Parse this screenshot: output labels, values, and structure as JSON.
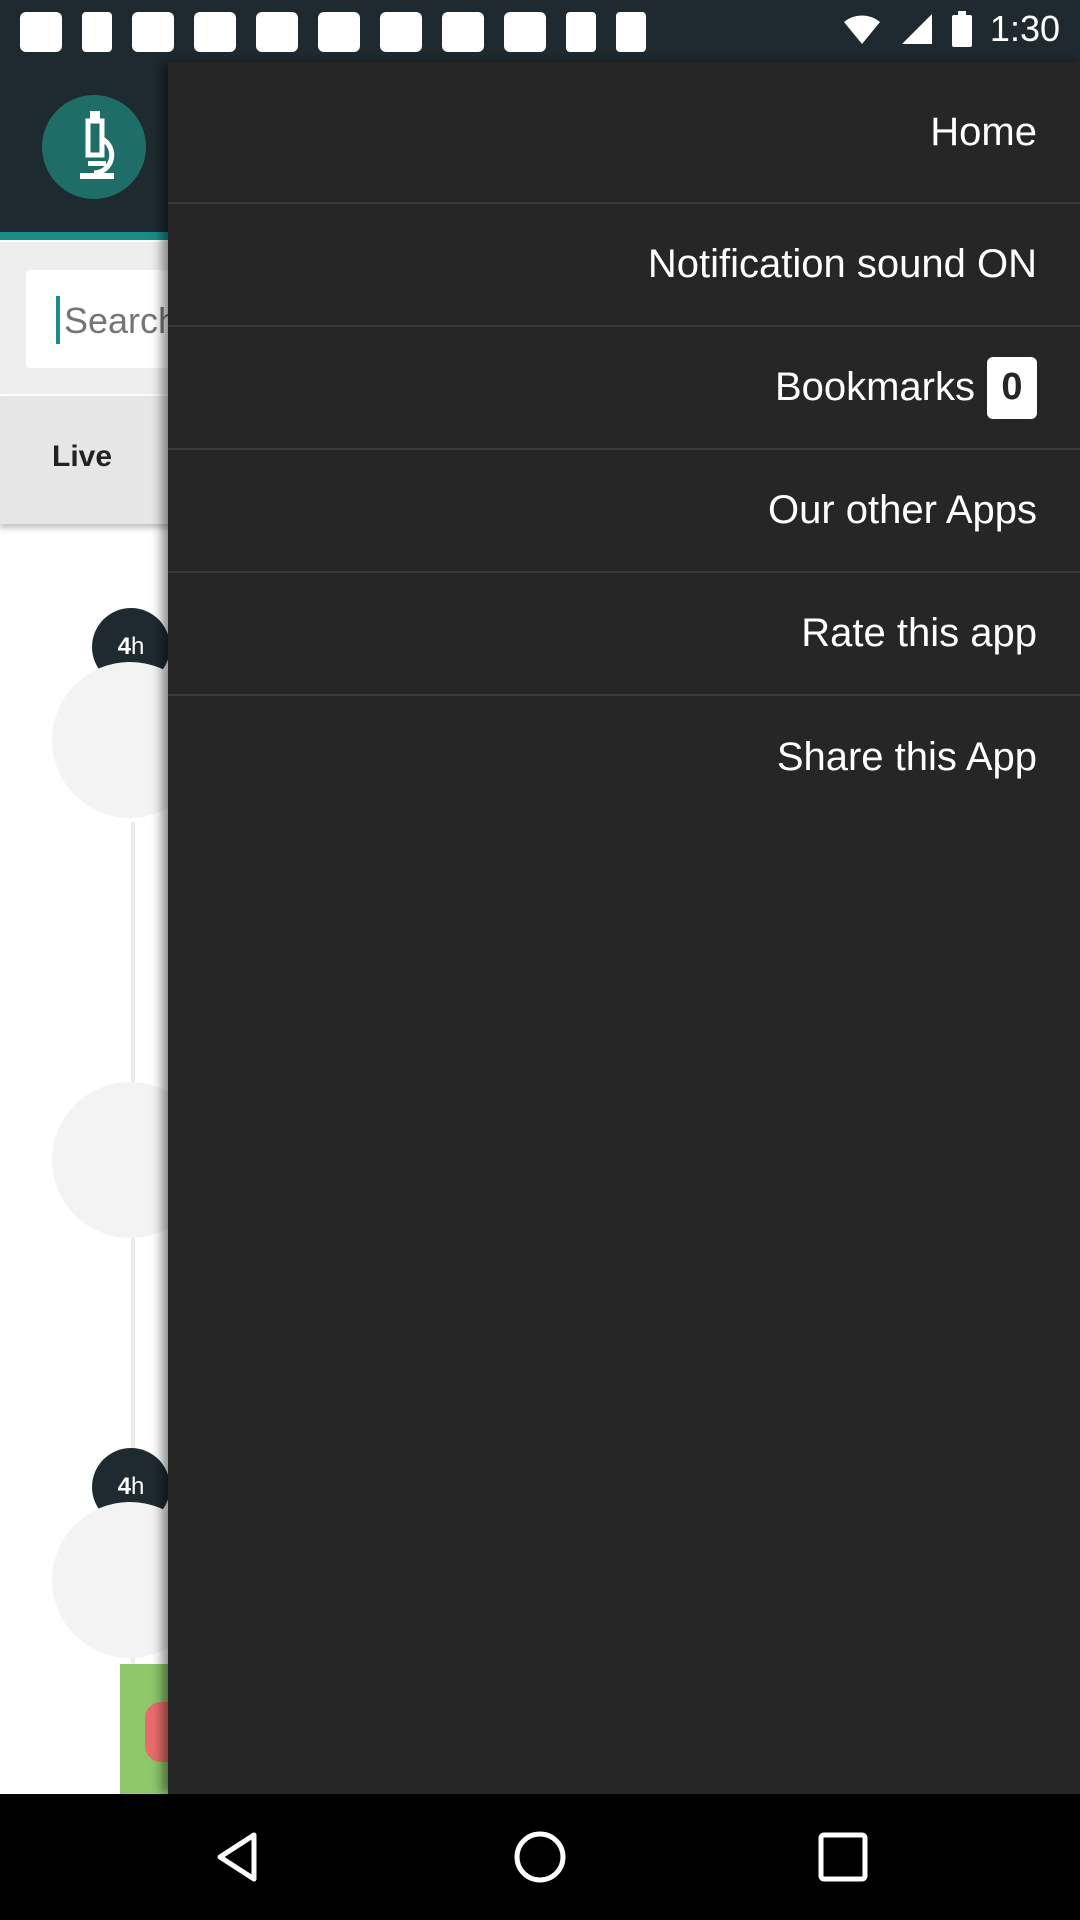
{
  "status_bar": {
    "time": "1:30",
    "icons": [
      "messages-icon",
      "notification-icon",
      "app-icon",
      "app-icon",
      "app-icon",
      "app-icon",
      "app-icon",
      "app-icon",
      "app-icon",
      "notification-icon",
      "download-icon",
      "wifi-icon",
      "signal-icon",
      "battery-icon"
    ]
  },
  "app": {
    "search_placeholder": "Search",
    "tabs": {
      "live": "Live"
    },
    "timeline": [
      {
        "time_num": "4",
        "time_unit": "h"
      },
      {
        "time_num": "4",
        "time_unit": "h"
      }
    ]
  },
  "drawer": {
    "items": [
      {
        "label": "Home"
      },
      {
        "label": "Notification sound ON"
      },
      {
        "label": "Bookmarks",
        "count": "0"
      },
      {
        "label": "Our other Apps"
      },
      {
        "label": "Rate this app"
      },
      {
        "label": "Share this App"
      }
    ]
  },
  "nav": {
    "back": "back-icon",
    "home": "home-icon",
    "recents": "recents-icon"
  },
  "colors": {
    "drawer_bg": "#262626",
    "header_bg": "#1e2a30",
    "accent": "#1a8b86",
    "logo_bg": "#1e6e67"
  }
}
